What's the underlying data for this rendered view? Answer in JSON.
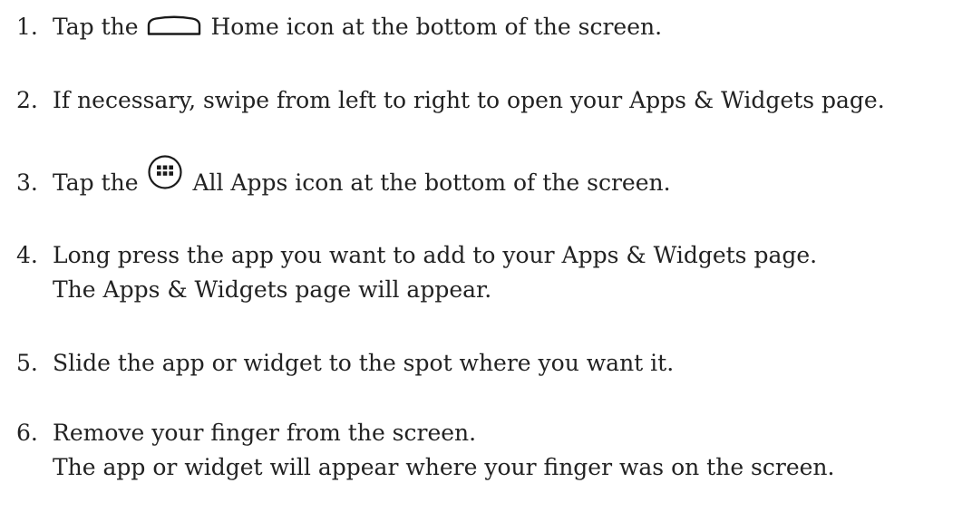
{
  "steps": [
    {
      "number": "1.",
      "before": "Tap the",
      "icon": "home-icon",
      "after": "Home icon at the bottom of the screen."
    },
    {
      "number": "2.",
      "text": "If necessary, swipe from left to right to open your Apps & Widgets page."
    },
    {
      "number": "3.",
      "before": "Tap the",
      "icon": "all-apps-icon",
      "after": "All Apps icon at the bottom of the screen."
    },
    {
      "number": "4.",
      "text": "Long press the app you want to add to your Apps & Widgets page.",
      "result": "The Apps & Widgets page will appear."
    },
    {
      "number": "5.",
      "text": "Slide the app or widget to the spot where you want it."
    },
    {
      "number": "6.",
      "text": "Remove your finger from the screen.",
      "result": "The app or widget will appear where your finger was on the screen."
    }
  ]
}
